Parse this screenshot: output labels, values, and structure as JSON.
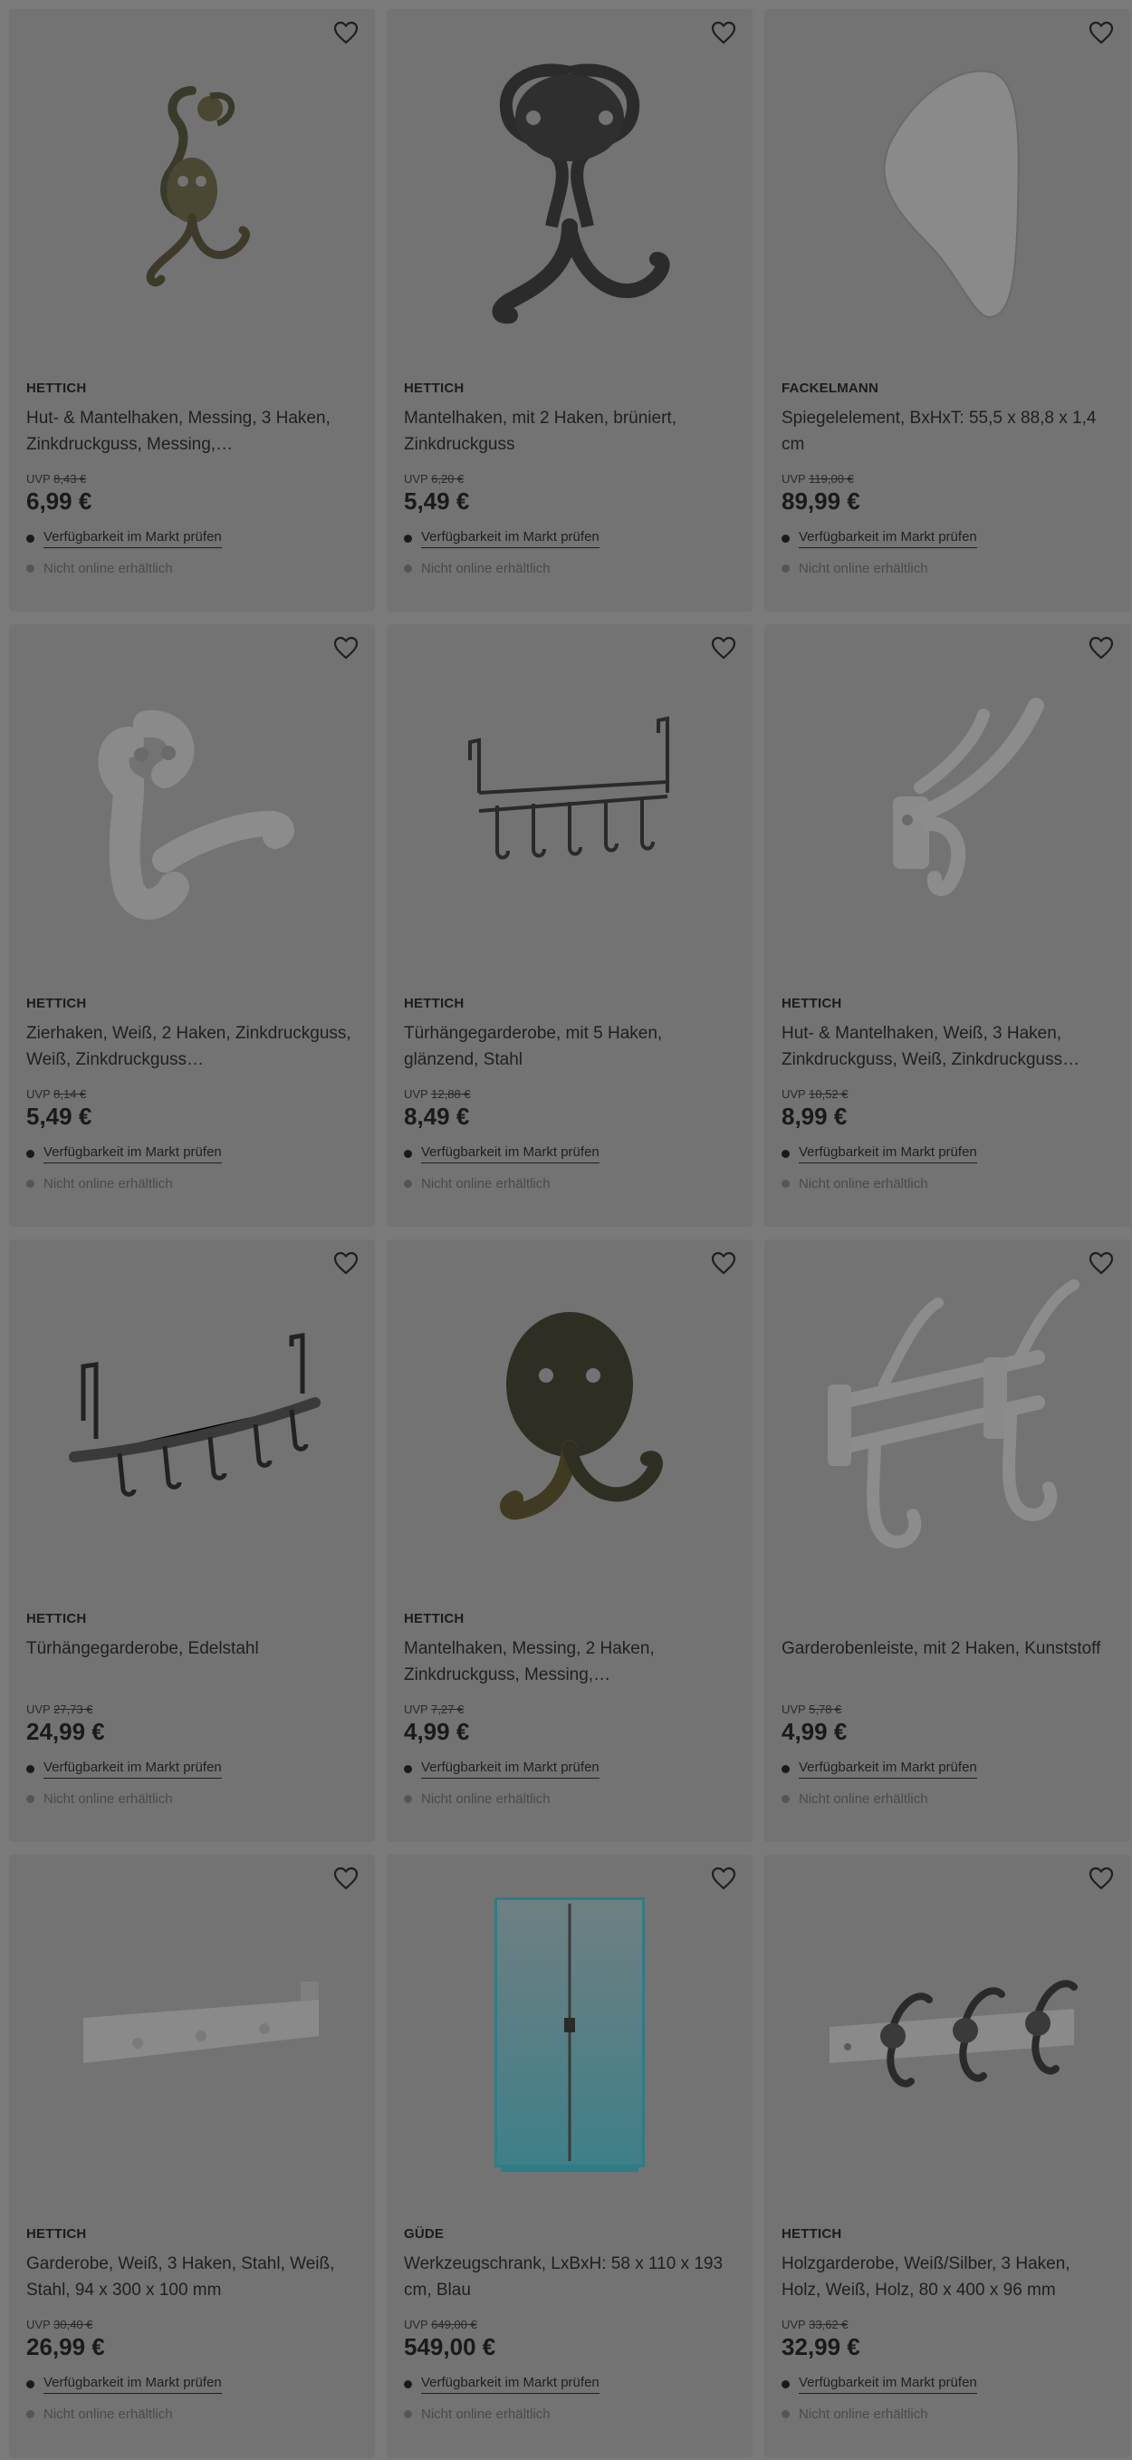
{
  "products": [
    {
      "brand": "HETTICH",
      "title": "Hut- & Mantelhaken, Messing, 3 Haken, Zinkdruckguss, Messing,…",
      "uvp_label": "UVP",
      "uvp_price": "8,43 €",
      "price": "6,99 €",
      "availability": "Verfügbarkeit im Markt prüfen",
      "online": "Nicht online erhältlich",
      "image": "brass-triple-hook"
    },
    {
      "brand": "HETTICH",
      "title": "Mantelhaken, mit 2 Haken, brüniert, Zinkdruckguss",
      "uvp_label": "UVP",
      "uvp_price": "6,20 €",
      "price": "5,49 €",
      "availability": "Verfügbarkeit im Markt prüfen",
      "online": "Nicht online erhältlich",
      "image": "dark-ornate-double-hook"
    },
    {
      "brand": "FACKELMANN",
      "title": "Spiegelelement, BxHxT: 55,5 x 88,8 x 1,4 cm",
      "uvp_label": "UVP",
      "uvp_price": "119,00 €",
      "price": "89,99 €",
      "availability": "Verfügbarkeit im Markt prüfen",
      "online": "Nicht online erhältlich",
      "image": "mirror-element"
    },
    {
      "brand": "HETTICH",
      "title": "Zierhaken, Weiß, 2 Haken, Zinkdruckguss, Weiß, Zinkdruckguss…",
      "uvp_label": "UVP",
      "uvp_price": "8,14 €",
      "price": "5,49 €",
      "availability": "Verfügbarkeit im Markt prüfen",
      "online": "Nicht online erhältlich",
      "image": "white-decorative-hook"
    },
    {
      "brand": "HETTICH",
      "title": "Türhängegarderobe, mit 5 Haken, glänzend, Stahl",
      "uvp_label": "UVP",
      "uvp_price": "12,88 €",
      "price": "8,49 €",
      "availability": "Verfügbarkeit im Markt prüfen",
      "online": "Nicht online erhältlich",
      "image": "door-rack-wire"
    },
    {
      "brand": "HETTICH",
      "title": "Hut- & Mantelhaken, Weiß, 3 Haken, Zinkdruckguss, Weiß, Zinkdruckguss…",
      "uvp_label": "UVP",
      "uvp_price": "10,52 €",
      "price": "8,99 €",
      "availability": "Verfügbarkeit im Markt prüfen",
      "online": "Nicht online erhältlich",
      "image": "white-triple-hook"
    },
    {
      "brand": "HETTICH",
      "title": "Türhängegarderobe, Edelstahl",
      "uvp_label": "UVP",
      "uvp_price": "27,73 €",
      "price": "24,99 €",
      "availability": "Verfügbarkeit im Markt prüfen",
      "online": "Nicht online erhältlich",
      "image": "door-rack-steel"
    },
    {
      "brand": "HETTICH",
      "title": "Mantelhaken, Messing, 2 Haken, Zinkdruckguss, Messing,…",
      "uvp_label": "UVP",
      "uvp_price": "7,27 €",
      "price": "4,99 €",
      "availability": "Verfügbarkeit im Markt prüfen",
      "online": "Nicht online erhältlich",
      "image": "brass-double-hook"
    },
    {
      "brand": "",
      "title": "Garderobenleiste, mit 2 Haken, Kunststoff",
      "uvp_label": "UVP",
      "uvp_price": "5,78 €",
      "price": "4,99 €",
      "availability": "Verfügbarkeit im Markt prüfen",
      "online": "Nicht online erhältlich",
      "image": "plastic-hook-rail"
    },
    {
      "brand": "HETTICH",
      "title": "Garderobe, Weiß, 3 Haken, Stahl, Weiß, Stahl, 94 x 300 x 100 mm",
      "uvp_label": "UVP",
      "uvp_price": "30,40 €",
      "price": "26,99 €",
      "availability": "Verfügbarkeit im Markt prüfen",
      "online": "Nicht online erhältlich",
      "image": "white-wall-rack"
    },
    {
      "brand": "GÜDE",
      "title": "Werkzeugschrank, LxBxH: 58 x 110 x 193 cm, Blau",
      "uvp_label": "UVP",
      "uvp_price": "649,00 €",
      "price": "549,00 €",
      "availability": "Verfügbarkeit im Markt prüfen",
      "online": "Nicht online erhältlich",
      "image": "tool-cabinet"
    },
    {
      "brand": "HETTICH",
      "title": "Holzgarderobe, Weiß/Silber, 3 Haken, Holz, Weiß, Holz, 80 x 400 x 96 mm",
      "uvp_label": "UVP",
      "uvp_price": "33,62 €",
      "price": "32,99 €",
      "availability": "Verfügbarkeit im Markt prüfen",
      "online": "Nicht online erhältlich",
      "image": "wood-hook-rail"
    }
  ],
  "colors": {
    "overlay_background": "#7a7a7a",
    "card_background": "#737373",
    "text": "#1f1f1f"
  }
}
